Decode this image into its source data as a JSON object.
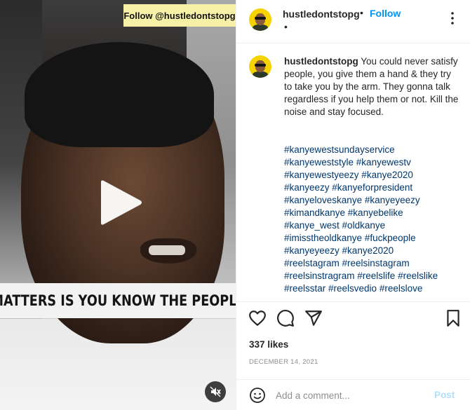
{
  "video": {
    "overlay_tag": "Follow @hustledontstopg",
    "caption_text": "MATTERS IS YOU KNOW THE PEOPLE",
    "play_icon": "play-icon",
    "mute_icon": "muted-speaker-icon"
  },
  "header": {
    "username": "hustledontstopg",
    "separator": "•",
    "follow_label": "Follow",
    "sub_separator": "•",
    "more_icon": "more-options-icon"
  },
  "post": {
    "username": "hustledontstopg",
    "caption": "You could never satisfy people, you give them a hand & they try to take you by the arm. They gonna talk regardless if you help them or not. Kill the noise and stay focused.",
    "hashtags": [
      "#kanyewestsundayservice",
      "#kanyeweststyle #kanyewestv",
      "#kanyewestyeezy #kanye2020",
      "#kanyeezy #kanyeforpresident",
      "#kanyeloveskanye #kanyeyeezy",
      "#kimandkanye #kanyebelike",
      "#kanye_west #oldkanye",
      "#imisstheoldkanye #fuckpeople",
      "#kanyeyeezy #kanye2020",
      "#reelstagram #reelsinstagram",
      "#reelsinstragram #reelslife #reelslike",
      "#reelsstar #reelsvedio #reelslove"
    ]
  },
  "actions": {
    "like_icon": "heart-icon",
    "comment_icon": "comment-icon",
    "share_icon": "share-icon",
    "save_icon": "bookmark-icon",
    "likes": "337 likes",
    "date": "DECEMBER 14, 2021"
  },
  "comment_box": {
    "placeholder": "Add a comment...",
    "post_label": "Post",
    "emoji_icon": "emoji-icon"
  },
  "colors": {
    "accent": "#0095f6",
    "hashtag": "#00376b",
    "post_disabled": "#b2dffc",
    "tag_bg": "#f7f1a8"
  }
}
